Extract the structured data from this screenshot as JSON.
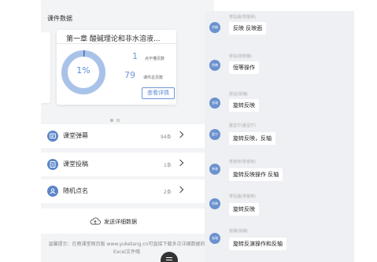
{
  "left_panel": {
    "section_title": "课件数据",
    "card": {
      "title": "第一章 酸碱理论和非水溶液...",
      "percent_label": "1%",
      "ring_fraction": 0.01,
      "unread_pages": "1",
      "unread_pages_label": "点不懂页数",
      "total_pages": "79",
      "total_pages_label": "课件总页数",
      "detail_button": "查看详情"
    },
    "carousel": {
      "pages": 2,
      "active": 0
    },
    "rows": [
      {
        "label": "课堂弹幕",
        "count": "94条",
        "icon": "danmaku-icon"
      },
      {
        "label": "课堂投稿",
        "count": "1条",
        "icon": "submission-icon"
      },
      {
        "label": "随机点名",
        "count": "2条",
        "icon": "roll-call-icon"
      }
    ],
    "send": {
      "label": "发送详细数据",
      "icon": "cloud-upload-icon"
    },
    "hint": "温馨提示：在雨课堂网页版 www.yuketang.cn可直接下载多次详细数据的Excel文件哦"
  },
  "chat": {
    "messages": [
      {
        "avatar": "洪琳",
        "sender": "李钰涵(李金林)",
        "text": "反映 反映面"
      },
      {
        "avatar": "徐楠",
        "sender": "李钰(徐李楠)",
        "text": "恒等操作"
      },
      {
        "avatar": "张瑞",
        "sender": "张钰(张瑞)",
        "text": "旋转反映"
      },
      {
        "avatar": "夏宁",
        "sender": "夏宝宁(夏宝宁)",
        "text": "旋转反映，反轴"
      },
      {
        "avatar": "李林",
        "sender": "李金林(李金林)",
        "text": "旋转反映操作 反轴"
      },
      {
        "avatar": "徐楠",
        "sender": "李钰涵(李金林)",
        "text": "旋转反映"
      },
      {
        "avatar": "张瑞",
        "sender": "张瑞(张瑞)",
        "text": "旋转反演操作和反轴"
      }
    ]
  },
  "colors": {
    "accent": "#5b86c8",
    "ring_track": "#a9c2e8",
    "chat_bg": "#eef0f3"
  }
}
